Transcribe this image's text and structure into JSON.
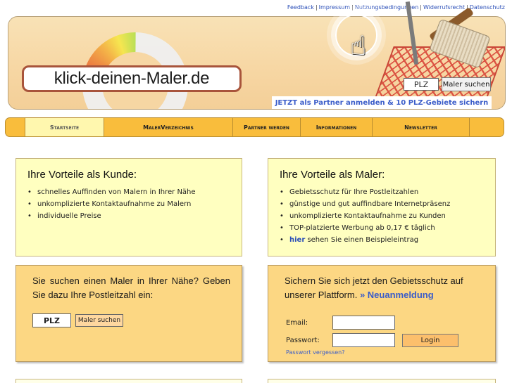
{
  "toplinks": [
    "Feedback",
    "Impressum",
    "Nutzungsbedingungen",
    "Widerrufsrecht",
    "Datenschutz"
  ],
  "header": {
    "logo_text": "klick-deinen-Maler.de",
    "plz_placeholder": "PLZ",
    "search_button": "Maler suchen",
    "partner_strip": "JETZT als Partner anmelden & 10 PLZ-Gebiete sichern"
  },
  "nav": [
    "Startseite",
    "MalerVerzeichnis",
    "Partner werden",
    "Informationen",
    "Newsletter"
  ],
  "kunde": {
    "title": "Ihre Vorteile als Kunde:",
    "items": [
      "schnelles Auffinden von Malern in Ihrer Nähe",
      "unkomplizierte Kontaktaufnahme zu Malern",
      "individuelle Preise"
    ]
  },
  "maler": {
    "title": "Ihre Vorteile als Maler:",
    "items": [
      "Gebietsschutz für Ihre Postleitzahlen",
      "günstige und gut auffindbare Internetpräsenz",
      "unkomplizierte Kontaktaufnahme zu Kunden",
      "TOP-platzierte Werbung ab 0,17 € täglich"
    ],
    "last_link": "hier",
    "last_text": " sehen Sie einen Beispieleintrag"
  },
  "search": {
    "text": "Sie suchen einen Maler in Ihrer Nähe? Geben Sie dazu Ihre Postleitzahl ein:",
    "plz": "PLZ",
    "button": "Maler suchen"
  },
  "login": {
    "text": "Sichern Sie sich jetzt den Gebietsschutz auf unserer Plattform.",
    "link": "» Neuanmeldung",
    "email_label": "Email:",
    "password_label": "Passwort:",
    "button": "Login",
    "forgot": "Passwort vergessen?"
  }
}
